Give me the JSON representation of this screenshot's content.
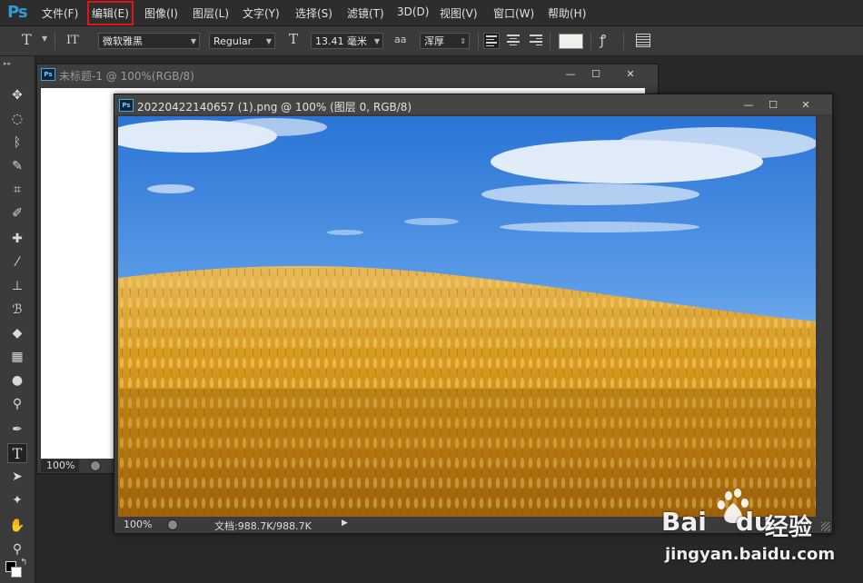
{
  "app": {
    "logo": "Ps"
  },
  "menu": [
    {
      "label": "文件(F)"
    },
    {
      "label": "编辑(E)",
      "highlighted": true
    },
    {
      "label": "图像(I)"
    },
    {
      "label": "图层(L)"
    },
    {
      "label": "文字(Y)"
    },
    {
      "label": "选择(S)"
    },
    {
      "label": "滤镜(T)"
    },
    {
      "label": "3D(D)"
    },
    {
      "label": "视图(V)"
    },
    {
      "label": "窗口(W)"
    },
    {
      "label": "帮助(H)"
    }
  ],
  "options": {
    "tool_glyph": "T",
    "orient_glyph": "IT",
    "font_family": "微软雅黑",
    "font_style": "Regular",
    "size_glyph": "T",
    "font_size": "13.41 毫米",
    "aa_glyph": "aa",
    "antialias": "浑厚",
    "text_color": "#f2eeea",
    "warp_glyph": "ꝭ"
  },
  "toolbar": {
    "grip": "▸▸",
    "tools": [
      {
        "name": "move-tool",
        "glyph": "✥"
      },
      {
        "name": "marquee-tool",
        "glyph": "◌"
      },
      {
        "name": "lasso-tool",
        "glyph": "ᛒ"
      },
      {
        "name": "quick-select-tool",
        "glyph": "✎"
      },
      {
        "name": "crop-tool",
        "glyph": "⌗"
      },
      {
        "name": "eyedropper-tool",
        "glyph": "✐"
      },
      {
        "name": "healing-tool",
        "glyph": "✚"
      },
      {
        "name": "brush-tool",
        "glyph": "⁄"
      },
      {
        "name": "stamp-tool",
        "glyph": "⊥"
      },
      {
        "name": "history-brush-tool",
        "glyph": "ℬ"
      },
      {
        "name": "eraser-tool",
        "glyph": "◆"
      },
      {
        "name": "gradient-tool",
        "glyph": "▦"
      },
      {
        "name": "blur-tool",
        "glyph": "●"
      },
      {
        "name": "dodge-tool",
        "glyph": "⚲"
      },
      {
        "name": "pen-tool",
        "glyph": "✒"
      },
      {
        "name": "type-tool",
        "glyph": "T",
        "active": true
      },
      {
        "name": "path-select-tool",
        "glyph": "➤"
      },
      {
        "name": "shape-tool",
        "glyph": "✦"
      },
      {
        "name": "hand-tool",
        "glyph": "✋"
      },
      {
        "name": "zoom-tool",
        "glyph": "⚲"
      }
    ]
  },
  "doc1": {
    "badge": "Ps",
    "title": "未标题-1 @ 100%(RGB/8)",
    "status_zoom": "100%"
  },
  "doc2": {
    "badge": "Ps",
    "title": "20220422140657 (1).png @ 100% (图层 0, RGB/8)",
    "status_zoom": "100%",
    "status_doc": "文档:988.7K/988.7K",
    "status_arrow": "▶"
  },
  "window_controls": {
    "minimize": "—",
    "maximize": "☐",
    "close": "✕"
  },
  "watermark": {
    "brand": "Bai",
    "brand2": "du",
    "cn": "经验",
    "url": "jingyan.baidu.com"
  }
}
